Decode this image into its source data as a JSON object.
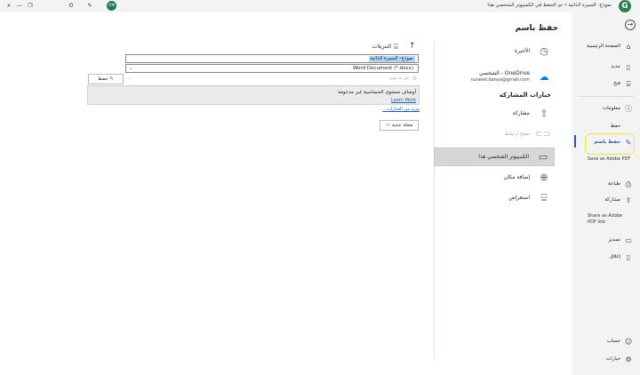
{
  "titlebar": {
    "title": "نموذج- السيرة الذاتية • تم الحفظ في الكمبيوتر الشخصي هذا",
    "avatar_initials": "ON",
    "logo_letter": "G",
    "buttons": [
      "×",
      "—",
      "❐",
      "ʘ",
      "⚙",
      "⤢",
      "⌖"
    ]
  },
  "nav": {
    "back_icon": "back-arrow-icon",
    "items": [
      {
        "label": "الصفحة الرئيسية",
        "icon": "home-icon"
      },
      {
        "label": "جديد",
        "icon": "new-document-icon"
      },
      {
        "label": "فتح",
        "icon": "open-folder-icon"
      },
      {
        "label": "معلومات",
        "icon": "info-icon"
      },
      {
        "label": "حفظ",
        "icon": ""
      },
      {
        "label": "حفظ باسم",
        "icon": "save-as-icon"
      },
      {
        "label": "Save as Adobe PDF",
        "icon": ""
      },
      {
        "label": "طباعة",
        "icon": "print-icon"
      },
      {
        "label": "مشاركة",
        "icon": "share-icon"
      },
      {
        "label": "Share as Adobe PDF link",
        "icon": ""
      },
      {
        "label": "تصدير",
        "icon": "export-icon"
      },
      {
        "label": "إغلاق",
        "icon": "close-icon"
      },
      {
        "label": "حساب",
        "icon": "account-icon"
      },
      {
        "label": "خيارات",
        "icon": "options-icon"
      }
    ]
  },
  "page": {
    "heading": "حفظ باسم"
  },
  "locations": {
    "recent": "الأخيرة",
    "onedrive_title": "OneDrive - الشخصي",
    "onedrive_email": "nuseeir.danya@gmail.com",
    "sharing_header": "خيارات المشاركة",
    "share": "مشاركة",
    "copy_link": "نسخ ارتباط",
    "this_pc": "الكمبيوتر الشخصي هذا",
    "add_place": "إضافة مكان",
    "browse": "استعراض"
  },
  "file_pane": {
    "path_label": "التنزيلات",
    "filename": "نموذج- السيرة الذاتية",
    "filetype": "Word Document (*.docx)",
    "encoding": "غير مدعوم",
    "save_label": "حفظ",
    "warning_text": "أوصاف مستوى الحساسية غير مدعومة",
    "learn_more": "Learn More",
    "more_options": "مزيد من الخيارات...",
    "new_folder": "مجلد جديد"
  },
  "colors": {
    "accent": "#2b579a",
    "highlight": "#f2e53a",
    "onedrive": "#0078d4"
  }
}
